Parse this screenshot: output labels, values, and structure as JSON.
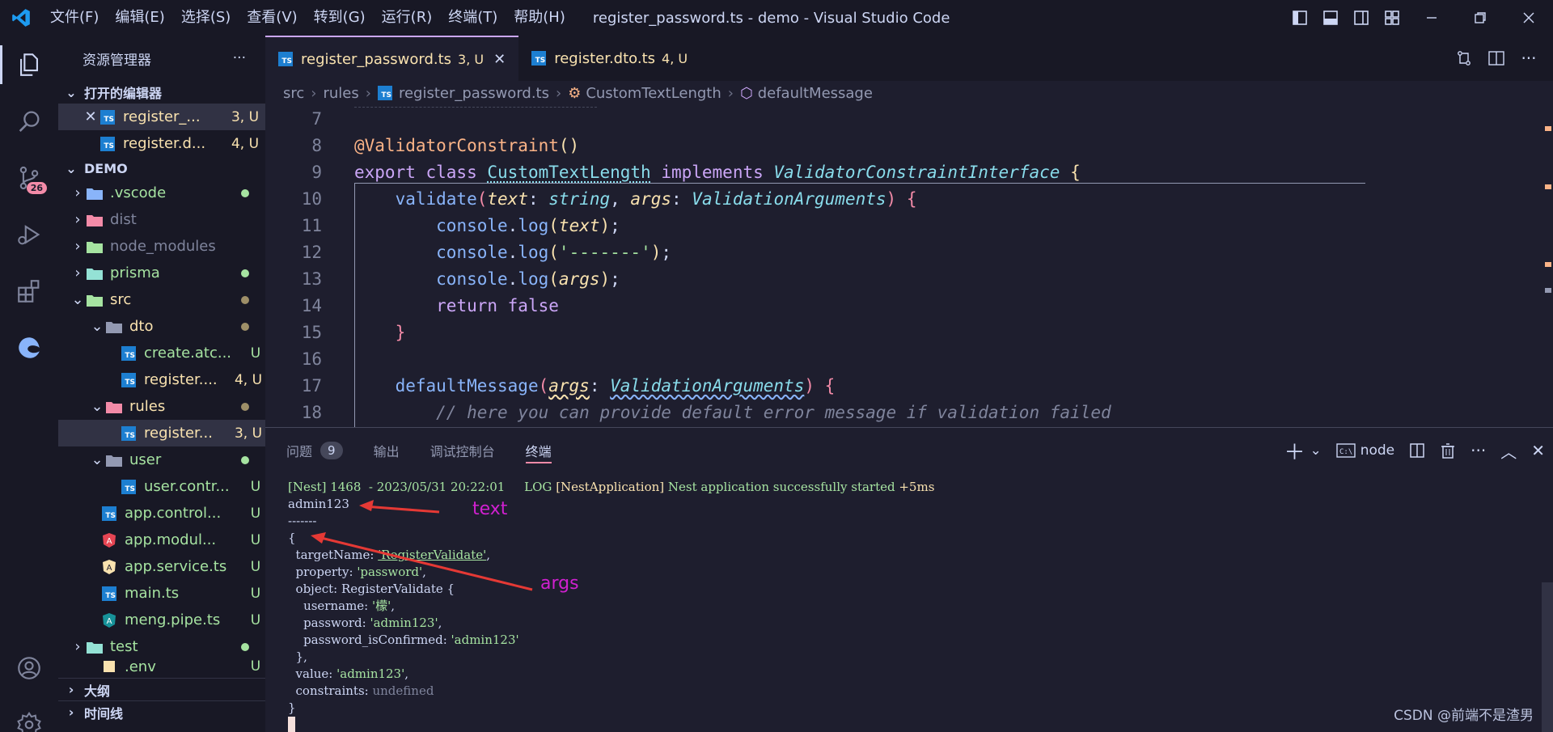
{
  "titlebar": {
    "menu": [
      "文件(F)",
      "编辑(E)",
      "选择(S)",
      "查看(V)",
      "转到(G)",
      "运行(R)",
      "终端(T)",
      "帮助(H)"
    ],
    "title": "register_password.ts - demo - Visual Studio Code"
  },
  "activity": {
    "scm_badge": "26"
  },
  "sidebar": {
    "header": "资源管理器",
    "open_editors_label": "打开的编辑器",
    "open_editors": [
      {
        "name": "register_...",
        "status": "3, U"
      },
      {
        "name": "register.d...",
        "status": "4, U"
      }
    ],
    "workspace_label": "DEMO",
    "tree": [
      {
        "name": ".vscode",
        "status": "",
        "kind": "folder"
      },
      {
        "name": "dist",
        "status": "",
        "kind": "folder"
      },
      {
        "name": "node_modules",
        "status": "",
        "kind": "folder"
      },
      {
        "name": "prisma",
        "status": "",
        "kind": "folder"
      },
      {
        "name": "src",
        "status": "",
        "kind": "folder"
      },
      {
        "name": "dto",
        "status": "",
        "kind": "folder"
      },
      {
        "name": "create.atc...",
        "status": "U",
        "kind": "file"
      },
      {
        "name": "register....",
        "status": "4, U",
        "kind": "file"
      },
      {
        "name": "rules",
        "status": "",
        "kind": "folder"
      },
      {
        "name": "register...",
        "status": "3, U",
        "kind": "file"
      },
      {
        "name": "user",
        "status": "",
        "kind": "folder"
      },
      {
        "name": "user.contr...",
        "status": "U",
        "kind": "file"
      },
      {
        "name": "app.control...",
        "status": "U",
        "kind": "file"
      },
      {
        "name": "app.modul...",
        "status": "U",
        "kind": "file"
      },
      {
        "name": "app.service.ts",
        "status": "U",
        "kind": "file"
      },
      {
        "name": "main.ts",
        "status": "U",
        "kind": "file"
      },
      {
        "name": "meng.pipe.ts",
        "status": "U",
        "kind": "file"
      },
      {
        "name": "test",
        "status": "",
        "kind": "folder"
      },
      {
        "name": ".env",
        "status": "U",
        "kind": "file"
      }
    ],
    "outline_label": "大纲",
    "timeline_label": "时间线"
  },
  "tabs": [
    {
      "label": "register_password.ts",
      "status": "3, U",
      "active": true
    },
    {
      "label": "register.dto.ts",
      "status": "4, U",
      "active": false
    }
  ],
  "breadcrumbs": [
    "src",
    "rules",
    "register_password.ts",
    "CustomTextLength",
    "defaultMessage"
  ],
  "editor": {
    "line_numbers": [
      "7",
      "8",
      "9",
      "10",
      "11",
      "12",
      "13",
      "14",
      "15",
      "16",
      "17",
      "18"
    ]
  },
  "panel": {
    "tabs": [
      "问题",
      "输出",
      "调试控制台",
      "终端"
    ],
    "problems_count": "9",
    "terminal_name": "node",
    "terminal_lines": {
      "l1_prefix": "[Nest] 1468  - 2023/05/31 20:22:01     LOG ",
      "l1_ctx": "[NestApplication]",
      "l1_msg": " Nest application successfully started ",
      "l1_time": "+5ms",
      "l2": "admin123",
      "l3": "-------",
      "l4": "{",
      "l5_key": "  targetName: ",
      "l5_val": "'RegisterValidate'",
      "l6_key": "  property: ",
      "l6_val": "'password'",
      "l7": "  object: RegisterValidate {",
      "l8_key": "    username: ",
      "l8_val": "'檬'",
      "l9_key": "    password: ",
      "l9_val": "'admin123'",
      "l10_key": "    password_isConfirmed: ",
      "l10_val": "'admin123'",
      "l11": "  },",
      "l12_key": "  value: ",
      "l12_val": "'admin123'",
      "l13_key": "  constraints: ",
      "l13_val": "undefined",
      "l14": "}"
    },
    "annotations": {
      "text": "text",
      "args": "args"
    },
    "watermark": "CSDN @前端不是渣男"
  },
  "colors": {
    "accent": "#cba6f7",
    "annotation": "#d020d0",
    "arrow": "#e53935"
  }
}
